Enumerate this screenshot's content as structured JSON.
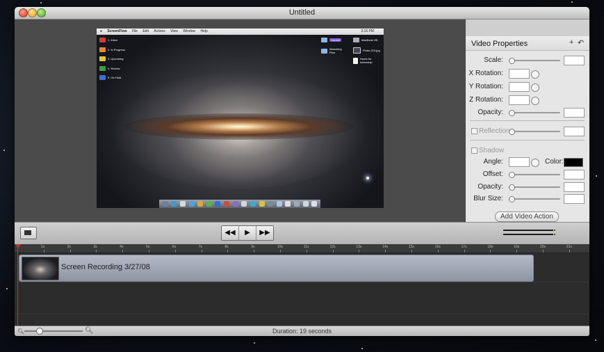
{
  "window": {
    "title": "Untitled"
  },
  "screen": {
    "menubar": {
      "apple": "",
      "items": [
        "ScreenFlow",
        "File",
        "Edit",
        "Actions",
        "View",
        "Window",
        "Help"
      ],
      "clock": "3:16 PM"
    },
    "left_folders": [
      {
        "label": "1. Inbox",
        "color": "#d83a2e"
      },
      {
        "label": "2. In Progress",
        "color": "#e9892a"
      },
      {
        "label": "3. Upcoming",
        "color": "#e7c530"
      },
      {
        "label": "4. Review",
        "color": "#3f9f3a"
      },
      {
        "label": "5. On Hold",
        "color": "#3a6fd0"
      }
    ],
    "right_items": [
      {
        "label": "Current",
        "kind": "folder"
      },
      {
        "label": "Marketing Plan",
        "kind": "folder"
      },
      {
        "label": "MacBook HD",
        "kind": "drive"
      },
      {
        "label": "Photo 210.jpg",
        "kind": "image"
      },
      {
        "label": "Hours for Internship",
        "kind": "document"
      }
    ]
  },
  "properties": {
    "title": "Video Properties",
    "add_icon": "plus-icon",
    "reset_icon": "undo-icon",
    "scale_label": "Scale:",
    "x_rotation_label": "X Rotation:",
    "y_rotation_label": "Y Rotation:",
    "z_rotation_label": "Z Rotation:",
    "opacity_label": "Opacity:",
    "reflection_label": "Reflection",
    "shadow_label": "Shadow",
    "angle_label": "Angle:",
    "color_label": "Color:",
    "offset_label": "Offset:",
    "shadow_opacity_label": "Opacity:",
    "blur_size_label": "Blur Size:",
    "add_action_label": "Add Video Action",
    "shadow_color": "#000000"
  },
  "transport": {
    "rewind_icon": "rewind-icon",
    "play_icon": "play-icon",
    "forward_icon": "fast-forward-icon",
    "rewind_glyph": "◀◀",
    "play_glyph": "▶",
    "forward_glyph": "▶▶"
  },
  "timeline": {
    "ticks": [
      "1s",
      "2s",
      "3s",
      "4s",
      "5s",
      "6s",
      "7s",
      "8s",
      "9s",
      "10s",
      "11s",
      "12s",
      "13s",
      "14s",
      "15s",
      "16s",
      "17s",
      "18s",
      "19s",
      "20s",
      "21s"
    ],
    "clip_label": "Screen Recording 3/27/08",
    "playhead_color": "#c5342d"
  },
  "status": {
    "duration": "Duration: 19 seconds"
  }
}
